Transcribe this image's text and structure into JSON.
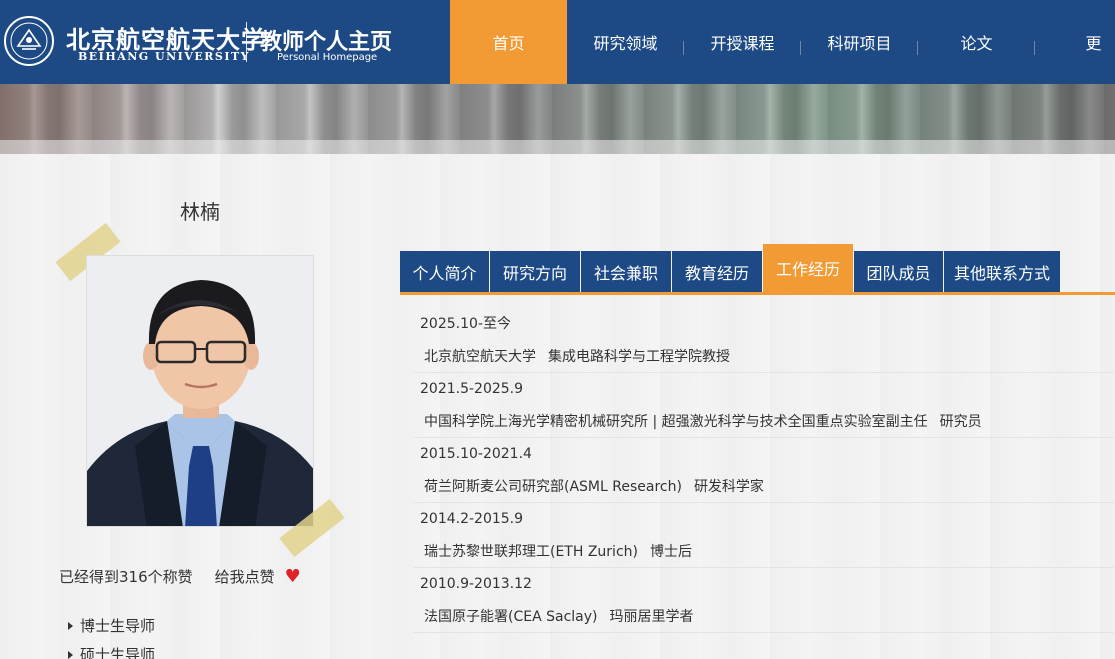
{
  "header": {
    "logo_cn": "北京航空航天大学",
    "logo_en": "BEIHANG UNIVERSITY",
    "homepage_cn": "教师个人主页",
    "homepage_en": "Personal Homepage",
    "nav": [
      {
        "label": "首页",
        "active": true
      },
      {
        "label": "研究领域",
        "active": false
      },
      {
        "label": "开授课程",
        "active": false
      },
      {
        "label": "科研项目",
        "active": false
      },
      {
        "label": "论文",
        "active": false
      },
      {
        "label": "更",
        "active": false
      }
    ]
  },
  "profile": {
    "name": "林楠",
    "likes_text": "已经得到316个称赞",
    "like_button": "给我点赞",
    "roles": [
      "博士生导师",
      "硕士生导师"
    ]
  },
  "tabs": [
    {
      "label": "个人简介",
      "active": false
    },
    {
      "label": "研究方向",
      "active": false
    },
    {
      "label": "社会兼职",
      "active": false
    },
    {
      "label": "教育经历",
      "active": false
    },
    {
      "label": "工作经历",
      "active": true
    },
    {
      "label": "团队成员",
      "active": false
    },
    {
      "label": "其他联系方式",
      "active": false
    }
  ],
  "work_experience": [
    {
      "period": "2025.10-至今",
      "org": "北京航空航天大学",
      "title": "集成电路科学与工程学院教授"
    },
    {
      "period": "2021.5-2025.9",
      "org": "中国科学院上海光学精密机械研究所 | 超强激光科学与技术全国重点实验室副主任",
      "title": "研究员"
    },
    {
      "period": "2015.10-2021.4",
      "org": "荷兰阿斯麦公司研究部(ASML Research)",
      "title": "研发科学家"
    },
    {
      "period": "2014.2-2015.9",
      "org": "瑞士苏黎世联邦理工(ETH Zurich)",
      "title": "博士后"
    },
    {
      "period": "2010.9-2013.12",
      "org": "法国原子能署(CEA Saclay)",
      "title": "玛丽居里学者"
    }
  ],
  "colors": {
    "brand_blue": "#1d4a85",
    "accent_orange": "#f29a33",
    "heart_red": "#e0202a"
  }
}
